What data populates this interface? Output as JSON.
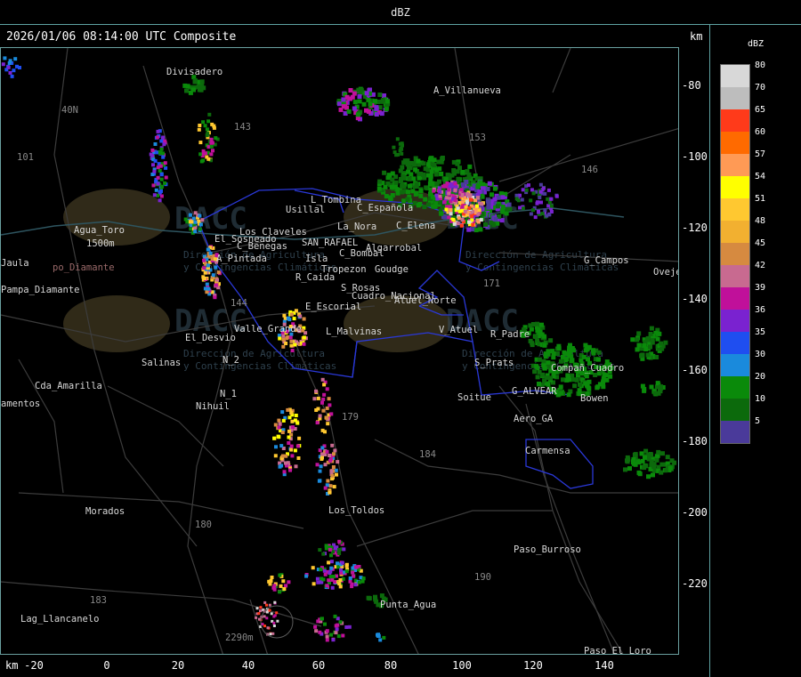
{
  "window_title": "dBZ",
  "header": "2026/01/06 08:14:00 UTC Composite",
  "unit_km": "km",
  "y_ticks": [
    "-80",
    "-100",
    "-120",
    "-140",
    "-160",
    "-180",
    "-200",
    "-220"
  ],
  "x_ticks": [
    "-20",
    "0",
    "20",
    "40",
    "60",
    "80",
    "100",
    "120",
    "140"
  ],
  "legend": {
    "title": "dBZ",
    "levels": [
      {
        "label": "80",
        "color": "#d8d8d8"
      },
      {
        "label": "70",
        "color": "#bdbdbd"
      },
      {
        "label": "65",
        "color": "#ff3a1a"
      },
      {
        "label": "60",
        "color": "#ff6a00"
      },
      {
        "label": "57",
        "color": "#ff9a55"
      },
      {
        "label": "54",
        "color": "#ffff00"
      },
      {
        "label": "51",
        "color": "#ffc830"
      },
      {
        "label": "48",
        "color": "#f2b030"
      },
      {
        "label": "45",
        "color": "#d68a40"
      },
      {
        "label": "42",
        "color": "#c86a90"
      },
      {
        "label": "39",
        "color": "#c0109a"
      },
      {
        "label": "36",
        "color": "#7a22d0"
      },
      {
        "label": "35",
        "color": "#1f4ef0"
      },
      {
        "label": "30",
        "color": "#1a8adc"
      },
      {
        "label": "20",
        "color": "#0a8a0a"
      },
      {
        "label": "10",
        "color": "#0c6a0c"
      },
      {
        "label": "5",
        "color": "#4a3a9a"
      }
    ]
  },
  "places": [
    {
      "name": "Divisadero"
    },
    {
      "name": "A_Villanueva"
    },
    {
      "name": "40N"
    },
    {
      "name": "101"
    },
    {
      "name": "Usillal"
    },
    {
      "name": "L_Tombina"
    },
    {
      "name": "C_Española"
    },
    {
      "name": "La_Nora"
    },
    {
      "name": "C_Elena"
    },
    {
      "name": "Agua_Toro"
    },
    {
      "name": "1500m"
    },
    {
      "name": "El_Sosneado"
    },
    {
      "name": "Los_Claveles"
    },
    {
      "name": "C_Benegas"
    },
    {
      "name": "SAN_RAFAEL"
    },
    {
      "name": "C_Bombal"
    },
    {
      "name": "Algarrobal"
    },
    {
      "name": "Goudge"
    },
    {
      "name": "Tropezon"
    },
    {
      "name": "Isla"
    },
    {
      "name": "R_Caida"
    },
    {
      "name": "S_Rosas"
    },
    {
      "name": "Cuadro_Nacional"
    },
    {
      "name": "E_Escorial"
    },
    {
      "name": "Atuel_Norte"
    },
    {
      "name": "V_Atuel"
    },
    {
      "name": "R_Padre"
    },
    {
      "name": "El_Desvio"
    },
    {
      "name": "Valle_Grande"
    },
    {
      "name": "L_Malvinas"
    },
    {
      "name": "Salinas"
    },
    {
      "name": "N_2"
    },
    {
      "name": "Cda_Amarilla"
    },
    {
      "name": "N_1"
    },
    {
      "name": "Nihuil"
    },
    {
      "name": "S_Prats"
    },
    {
      "name": "G_ALVEAR"
    },
    {
      "name": "Bowen"
    },
    {
      "name": "Soitue"
    },
    {
      "name": "Aero_GA"
    },
    {
      "name": "Carmensa"
    },
    {
      "name": "G_Campos"
    },
    {
      "name": "Ovejero"
    },
    {
      "name": "Compañ_Cuadro"
    },
    {
      "name": "Morados"
    },
    {
      "name": "Los_Toldos"
    },
    {
      "name": "Paso_Burroso"
    },
    {
      "name": "Punta_Agua"
    },
    {
      "name": "Lag_Llancanelo"
    },
    {
      "name": "Paso_El_Loro"
    },
    {
      "name": "Pampa_Diamante"
    },
    {
      "name": "po_Diamante"
    },
    {
      "name": "Jaula"
    },
    {
      "name": "amentos"
    },
    {
      "name": "2290m"
    },
    {
      "name": "143"
    },
    {
      "name": "153"
    },
    {
      "name": "146"
    },
    {
      "name": "171"
    },
    {
      "name": "179"
    },
    {
      "name": "184"
    },
    {
      "name": "180"
    },
    {
      "name": "183"
    },
    {
      "name": "190"
    },
    {
      "name": "144"
    },
    {
      "name": "A_Pintada"
    }
  ],
  "watermark": {
    "logo": "DACC",
    "line1": "Dirección de Agricultura",
    "line2": "y Contingencias Climáticas"
  }
}
